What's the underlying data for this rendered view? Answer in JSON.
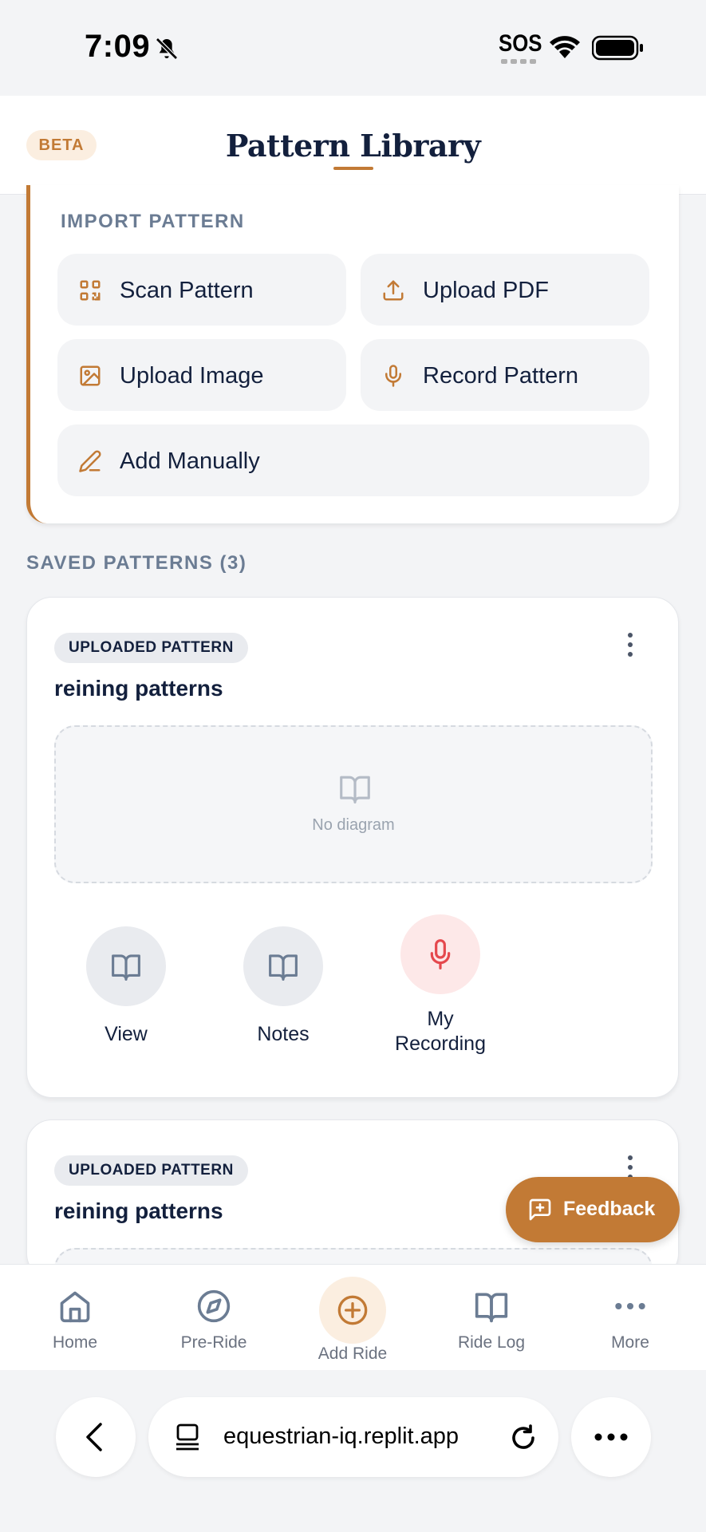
{
  "status_bar": {
    "time": "7:09",
    "sos": "SOS"
  },
  "header": {
    "beta": "BETA",
    "title": "Pattern Library"
  },
  "import": {
    "title": "IMPORT PATTERN",
    "buttons": [
      {
        "label": "Scan Pattern",
        "icon": "qr-scan-icon"
      },
      {
        "label": "Upload PDF",
        "icon": "upload-icon"
      },
      {
        "label": "Upload Image",
        "icon": "image-icon"
      },
      {
        "label": "Record Pattern",
        "icon": "microphone-icon"
      },
      {
        "label": "Add Manually",
        "icon": "pencil-icon"
      }
    ]
  },
  "saved": {
    "label": "SAVED PATTERNS (3)",
    "patterns": [
      {
        "badge": "UPLOADED PATTERN",
        "name": "reining patterns",
        "diagram_placeholder": "No diagram",
        "actions": [
          {
            "label": "View",
            "icon": "book-icon"
          },
          {
            "label": "Notes",
            "icon": "book-icon"
          },
          {
            "label": "My Recording",
            "icon": "microphone-icon"
          }
        ]
      },
      {
        "badge": "UPLOADED PATTERN",
        "name": "reining patterns"
      }
    ]
  },
  "feedback": {
    "label": "Feedback"
  },
  "nav": {
    "items": [
      {
        "label": "Home",
        "icon": "home-icon"
      },
      {
        "label": "Pre-Ride",
        "icon": "compass-icon"
      },
      {
        "label": "Add Ride",
        "icon": "plus-circle-icon"
      },
      {
        "label": "Ride Log",
        "icon": "book-icon"
      },
      {
        "label": "More",
        "icon": "more-icon"
      }
    ]
  },
  "browser": {
    "url": "equestrian-iq.replit.app"
  },
  "colors": {
    "accent": "#c27a35",
    "navy": "#13203d",
    "muted": "#6b7c93",
    "record": "#e5484d"
  }
}
